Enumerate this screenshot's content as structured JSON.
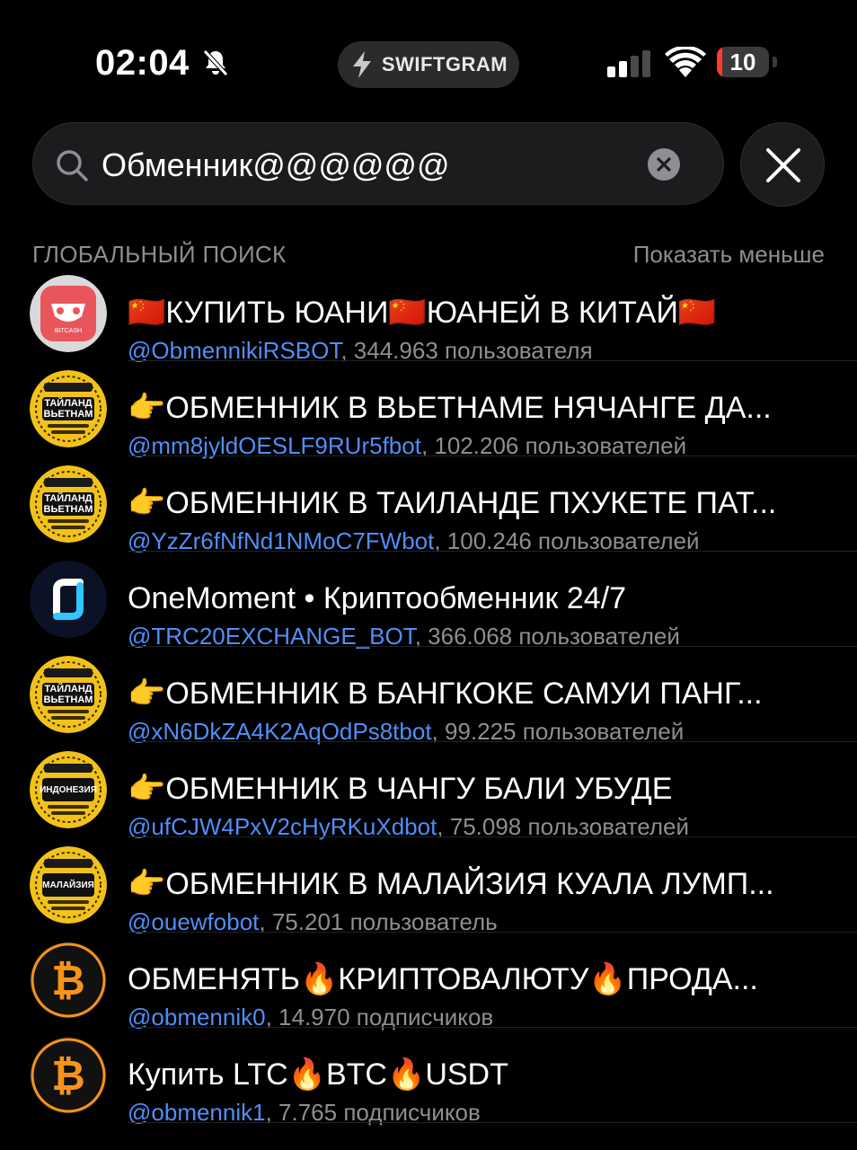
{
  "status": {
    "time": "02:04",
    "app_badge": "SWIFTGRAM",
    "battery_level": 10,
    "battery_label": "10"
  },
  "search": {
    "query": "Обменник@@@@@@"
  },
  "section": {
    "title": "ГЛОБАЛЬНЫЙ ПОИСК",
    "action": "Показать меньше"
  },
  "results": [
    {
      "title": "🇨🇳КУПИТЬ ЮАНИ🇨🇳ЮАНЕЙ В КИТАЙ🇨🇳",
      "handle": "@ObmennikiRSBOT",
      "meta": ", 344.963 пользователя",
      "avatar": "bitcash",
      "avatar_label": "BITCASH"
    },
    {
      "title": "👉ОБМЕННИК В ВЬЕТНАМЕ НЯЧАНГЕ ДА...",
      "handle": "@mm8jyldOESLF9RUr5fbot",
      "meta": ", 102.206 пользователей",
      "avatar": "badge",
      "avatar_label": "ТАЙЛАНД ВЬЕТНАМ"
    },
    {
      "title": "👉ОБМЕННИК В ТАИЛАНДЕ ПХУКЕТЕ ПАТ...",
      "handle": "@YzZr6fNfNd1NMoC7FWbot",
      "meta": ", 100.246 пользователей",
      "avatar": "badge",
      "avatar_label": "ТАЙЛАНД ВЬЕТНАМ"
    },
    {
      "title": "OneMoment • Криптообменник 24/7",
      "handle": "@TRC20EXCHANGE_BOT",
      "meta": ", 366.068 пользователей",
      "avatar": "onemoment",
      "avatar_label": ""
    },
    {
      "title": "👉ОБМЕННИК В БАНГКОКЕ САМУИ ПАНГ...",
      "handle": "@xN6DkZA4K2AqOdPs8tbot",
      "meta": ", 99.225 пользователей",
      "avatar": "badge",
      "avatar_label": "ТАЙЛАНД ВЬЕТНАМ"
    },
    {
      "title": "👉ОБМЕННИК В ЧАНГУ БАЛИ УБУДЕ",
      "handle": "@ufCJW4PxV2cHyRKuXdbot",
      "meta": ", 75.098 пользователей",
      "avatar": "badge",
      "avatar_label": "ИНДОНЕЗИЯ"
    },
    {
      "title": "👉ОБМЕННИК В МАЛАЙЗИЯ КУАЛА ЛУМП...",
      "handle": "@ouewfobot",
      "meta": ", 75.201 пользователь",
      "avatar": "badge",
      "avatar_label": "МАЛАЙЗИЯ"
    },
    {
      "title": "ОБМЕНЯТЬ🔥КРИПТОВАЛЮТУ🔥ПРОДА...",
      "handle": "@obmennik0",
      "meta": ", 14.970 подписчиков",
      "avatar": "bitcoin",
      "avatar_label": ""
    },
    {
      "title": "Купить LTC🔥BTC🔥USDT",
      "handle": "@obmennik1",
      "meta": ", 7.765 подписчиков",
      "avatar": "bitcoin",
      "avatar_label": ""
    }
  ],
  "colors": {
    "accent": "#4f8ff7",
    "badge_yellow": "#f2c21a",
    "bitcoin_orange": "#f7931a",
    "bitcash_red": "#e8565c"
  }
}
